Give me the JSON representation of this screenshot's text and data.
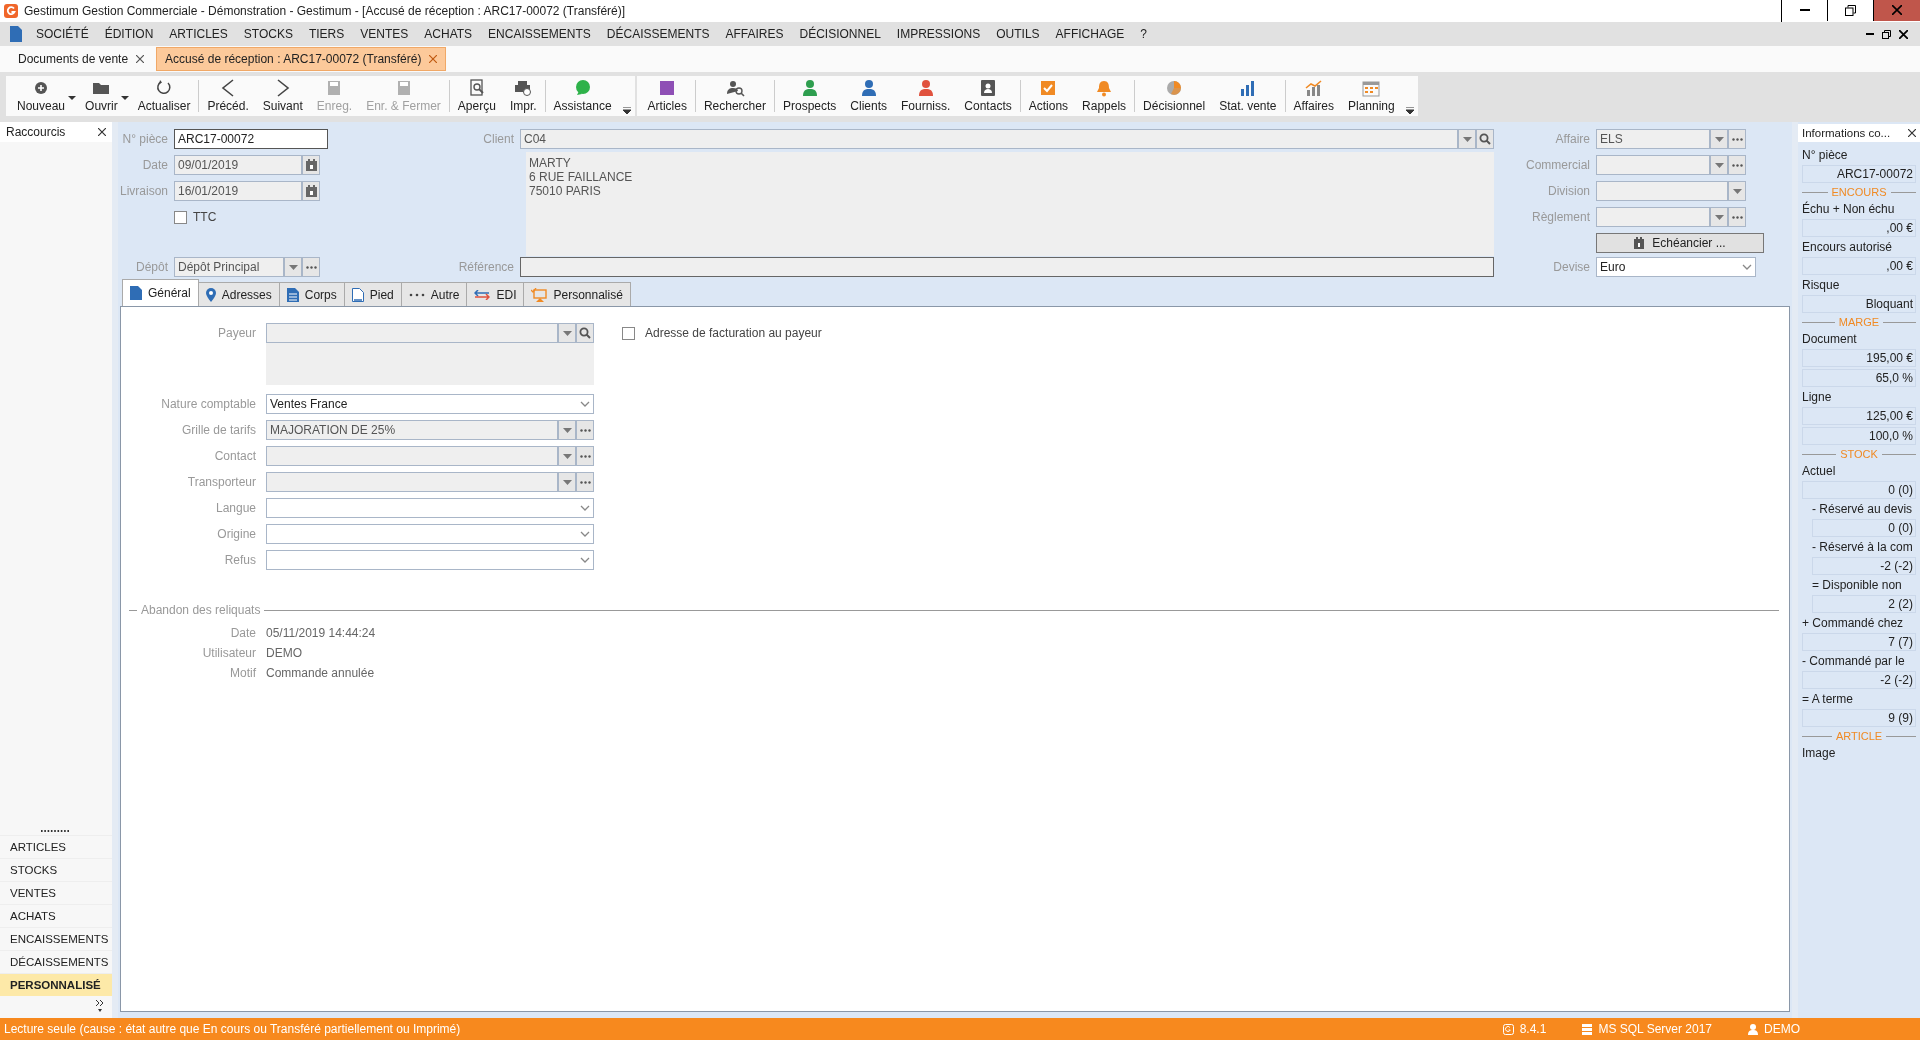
{
  "window": {
    "title": "Gestimum Gestion Commerciale - Démonstration - Gestimum - [Accusé de réception : ARC17-00072 (Transféré)]"
  },
  "menu": [
    "SOCIÉTÉ",
    "ÉDITION",
    "ARTICLES",
    "STOCKS",
    "TIERS",
    "VENTES",
    "ACHATS",
    "ENCAISSEMENTS",
    "DÉCAISSEMENTS",
    "AFFAIRES",
    "DÉCISIONNEL",
    "IMPRESSIONS",
    "OUTILS",
    "AFFICHAGE",
    "?"
  ],
  "document_tabs": [
    {
      "label": "Documents de vente",
      "selected": false
    },
    {
      "label": "Accusé de réception : ARC17-00072 (Transféré)",
      "selected": true
    }
  ],
  "toolbars": [
    {
      "sections": [
        {
          "items": [
            {
              "label": "Nouveau",
              "dropdown": true,
              "disabled": false
            },
            {
              "label": "Ouvrir",
              "dropdown": true,
              "disabled": false
            },
            {
              "label": "Actualiser",
              "dropdown": false,
              "disabled": false
            }
          ]
        },
        {
          "items": [
            {
              "label": "Précéd.",
              "dropdown": false,
              "disabled": false
            },
            {
              "label": "Suivant",
              "dropdown": false,
              "disabled": false
            },
            {
              "label": "Enreg.",
              "dropdown": false,
              "disabled": true
            },
            {
              "label": "Enr. & Fermer",
              "dropdown": false,
              "disabled": true
            }
          ]
        },
        {
          "items": [
            {
              "label": "Aperçu",
              "dropdown": false,
              "disabled": false
            },
            {
              "label": "Impr.",
              "dropdown": false,
              "disabled": false
            }
          ]
        },
        {
          "items": [
            {
              "label": "Assistance",
              "dropdown": false,
              "disabled": false
            }
          ]
        }
      ]
    },
    {
      "sections": [
        {
          "items": [
            {
              "label": "Articles",
              "dropdown": false,
              "disabled": false
            }
          ]
        },
        {
          "items": [
            {
              "label": "Rechercher",
              "dropdown": false,
              "disabled": false
            }
          ]
        },
        {
          "items": [
            {
              "label": "Prospects",
              "dropdown": false,
              "disabled": false
            },
            {
              "label": "Clients",
              "dropdown": false,
              "disabled": false
            },
            {
              "label": "Fourniss.",
              "dropdown": false,
              "disabled": false
            },
            {
              "label": "Contacts",
              "dropdown": false,
              "disabled": false
            }
          ]
        },
        {
          "items": [
            {
              "label": "Actions",
              "dropdown": false,
              "disabled": false
            },
            {
              "label": "Rappels",
              "dropdown": false,
              "disabled": false
            }
          ]
        },
        {
          "items": [
            {
              "label": "Décisionnel",
              "dropdown": false,
              "disabled": false
            },
            {
              "label": "Stat. vente",
              "dropdown": false,
              "disabled": false
            }
          ]
        },
        {
          "items": [
            {
              "label": "Affaires",
              "dropdown": false,
              "disabled": false
            },
            {
              "label": "Planning",
              "dropdown": false,
              "disabled": false
            }
          ]
        }
      ]
    }
  ],
  "shortcuts": {
    "title": "Raccourcis",
    "items": [
      {
        "label": "ARTICLES",
        "selected": false
      },
      {
        "label": "STOCKS",
        "selected": false
      },
      {
        "label": "VENTES",
        "selected": false
      },
      {
        "label": "ACHATS",
        "selected": false
      },
      {
        "label": "ENCAISSEMENTS",
        "selected": false
      },
      {
        "label": "DÉCAISSEMENTS",
        "selected": false
      },
      {
        "label": "PERSONNALISÉ",
        "selected": true
      }
    ]
  },
  "header": {
    "piece": {
      "label": "N° pièce",
      "value": "ARC17-00072"
    },
    "date": {
      "label": "Date",
      "value": "09/01/2019"
    },
    "delivery": {
      "label": "Livraison",
      "value": "16/01/2019"
    },
    "ttc": {
      "label": "TTC",
      "checked": false
    },
    "client": {
      "label": "Client",
      "value": "C04",
      "address": [
        "MARTY",
        "6 RUE FAILLANCE",
        "75010 PARIS"
      ]
    },
    "depot": {
      "label": "Dépôt",
      "value": "Dépôt Principal"
    },
    "reference": {
      "label": "Référence"
    },
    "right_fields": [
      {
        "label": "Affaire",
        "value": "ELS"
      },
      {
        "label": "Commercial"
      },
      {
        "label": "Division"
      },
      {
        "label": "Règlement"
      }
    ],
    "schedule_button": "Echéancier ...",
    "currency": {
      "label": "Devise",
      "value": "Euro"
    }
  },
  "tabs": [
    {
      "label": "Général",
      "selected": true
    },
    {
      "label": "Adresses",
      "selected": false
    },
    {
      "label": "Corps",
      "selected": false
    },
    {
      "label": "Pied",
      "selected": false
    },
    {
      "label": "Autre",
      "selected": false
    },
    {
      "label": "EDI",
      "selected": false
    },
    {
      "label": "Personnalisé",
      "selected": false
    }
  ],
  "general": {
    "payer": {
      "label": "Payeur",
      "disabled": true
    },
    "payer_checkbox": {
      "label": "Adresse de facturation au payeur",
      "checked": false
    },
    "fields": [
      {
        "label": "Nature comptable",
        "value": "Ventes France",
        "disabled": false
      },
      {
        "label": "Grille de tarifs",
        "value": "MAJORATION DE 25%",
        "disabled": true
      },
      {
        "label": "Contact",
        "disabled": true
      },
      {
        "label": "Transporteur",
        "disabled": true
      },
      {
        "label": "Langue",
        "disabled": false
      },
      {
        "label": "Origine",
        "disabled": false
      },
      {
        "label": "Refus",
        "disabled": false
      }
    ],
    "abandon": {
      "title": "Abandon des reliquats",
      "rows": [
        {
          "label": "Date",
          "value": "05/11/2019 14:44:24"
        },
        {
          "label": "Utilisateur",
          "value": "DEMO"
        },
        {
          "label": "Motif",
          "value": "Commande annulée"
        }
      ]
    }
  },
  "info_panel": {
    "title": "Informations co...",
    "rows": [
      {
        "kind": "label",
        "text": "N° pièce"
      },
      {
        "kind": "value",
        "text": "ARC17-00072"
      },
      {
        "kind": "section",
        "text": "ENCOURS"
      },
      {
        "kind": "label",
        "text": "Échu + Non échu"
      },
      {
        "kind": "value",
        "text": ",00 €"
      },
      {
        "kind": "label",
        "text": "Encours autorisé"
      },
      {
        "kind": "value",
        "text": ",00 €"
      },
      {
        "kind": "label",
        "text": "Risque"
      },
      {
        "kind": "value",
        "text": "Bloquant"
      },
      {
        "kind": "section",
        "text": "MARGE"
      },
      {
        "kind": "label",
        "text": "Document"
      },
      {
        "kind": "value",
        "text": "195,00 €"
      },
      {
        "kind": "value",
        "text": "65,0 %"
      },
      {
        "kind": "label",
        "text": "Ligne"
      },
      {
        "kind": "value",
        "text": "125,00 €"
      },
      {
        "kind": "value",
        "text": "100,0 %"
      },
      {
        "kind": "section",
        "text": "STOCK"
      },
      {
        "kind": "label",
        "text": "Actuel"
      },
      {
        "kind": "value",
        "text": "0 (0)"
      },
      {
        "kind": "sublabel",
        "text": "- Réservé au devis"
      },
      {
        "kind": "subvalue",
        "text": "0 (0)"
      },
      {
        "kind": "sublabel",
        "text": "- Réservé à la com"
      },
      {
        "kind": "subvalue",
        "text": "-2 (-2)"
      },
      {
        "kind": "sublabel",
        "text": "= Disponible non"
      },
      {
        "kind": "subvalue",
        "text": "2 (2)"
      },
      {
        "kind": "label",
        "text": "+ Commandé chez"
      },
      {
        "kind": "value",
        "text": "7 (7)"
      },
      {
        "kind": "label",
        "text": "- Commandé par le"
      },
      {
        "kind": "value",
        "text": "-2 (-2)"
      },
      {
        "kind": "label",
        "text": "= A terme"
      },
      {
        "kind": "value",
        "text": "9 (9)"
      },
      {
        "kind": "section",
        "text": "ARTICLE"
      },
      {
        "kind": "label",
        "text": "Image"
      }
    ]
  },
  "status_bar": {
    "message": "Lecture seule (cause : état autre que En cours ou Transféré partiellement ou Imprimé)",
    "version": "8.4.1",
    "server": "MS SQL Server 2017",
    "user": "DEMO"
  }
}
